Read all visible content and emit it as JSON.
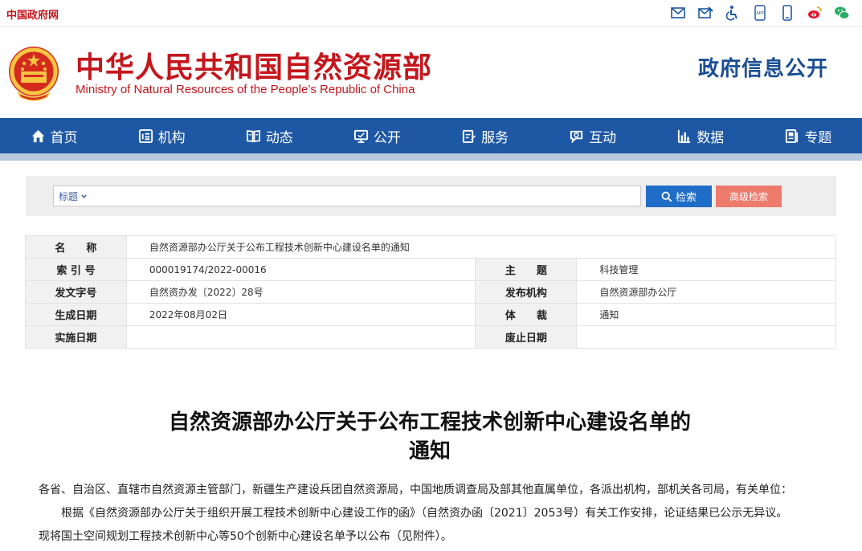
{
  "topbar": {
    "gov_link": "中国政府网",
    "icons": [
      "mail-icon",
      "mail-edit-icon",
      "accessibility-icon",
      "app-icon",
      "mobile-icon",
      "weibo-icon",
      "wechat-icon"
    ]
  },
  "header": {
    "title": "中华人民共和国自然资源部",
    "subtitle": "Ministry of Natural Resources of the People’s Republic of China",
    "right_title": "政府信息公开"
  },
  "nav": {
    "items": [
      {
        "label": "首页",
        "icon": "home-icon"
      },
      {
        "label": "机构",
        "icon": "org-icon"
      },
      {
        "label": "动态",
        "icon": "book-icon"
      },
      {
        "label": "公开",
        "icon": "monitor-icon"
      },
      {
        "label": "服务",
        "icon": "service-icon"
      },
      {
        "label": "互动",
        "icon": "chat-icon"
      },
      {
        "label": "数据",
        "icon": "bar-chart-icon"
      },
      {
        "label": "专题",
        "icon": "topic-icon"
      }
    ]
  },
  "search": {
    "type_label": "标题",
    "query": "",
    "search_label": "检索",
    "advanced_label": "高级检索"
  },
  "meta": {
    "name_label": "名　　称",
    "name_value": "自然资源部办公厅关于公布工程技术创新中心建设名单的通知",
    "index_label": "索 引 号",
    "index_value": "000019174/2022-00016",
    "topic_label": "主　　题",
    "topic_value": "科技管理",
    "doc_no_label": "发文字号",
    "doc_no_value": "自然资办发〔2022〕28号",
    "issuer_label": "发布机构",
    "issuer_value": "自然资源部办公厅",
    "date_label": "生成日期",
    "date_value": "2022年08月02日",
    "genre_label": "体　　裁",
    "genre_value": "通知",
    "effective_label": "实施日期",
    "effective_value": "",
    "repeal_label": "废止日期",
    "repeal_value": ""
  },
  "article": {
    "title_line1": "自然资源部办公厅关于公布工程技术创新中心建设名单的",
    "title_line2": "通知",
    "addressee": "各省、自治区、直辖市自然资源主管部门，新疆生产建设兵团自然资源局，中国地质调查局及部其他直属单位，各派出机构，部机关各司局，有关单位：",
    "body_line1": "根据《自然资源部办公厅关于组织开展工程技术创新中心建设工作的函》（自然资办函〔2021〕2053号）有关工作安排，论证结果已公示无异议。",
    "body_line2": "现将国土空间规划工程技术创新中心等50个创新中心建设名单予以公布（见附件）。"
  }
}
